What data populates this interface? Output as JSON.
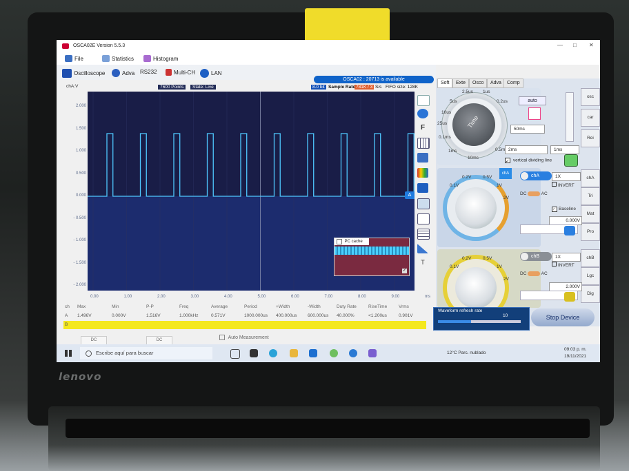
{
  "window": {
    "title": "OSCA02E Version 5.5.3"
  },
  "menu": [
    {
      "label": "File",
      "icon": "file-icon"
    },
    {
      "label": "Statistics",
      "icon": "statistics-icon"
    },
    {
      "label": "Histogram",
      "icon": "histogram-icon"
    }
  ],
  "toolbar": [
    {
      "label": "Oscilloscope",
      "icon": "oscilloscope-icon"
    },
    {
      "label": "Adva",
      "icon": "gear-icon"
    },
    {
      "label": "RS232",
      "icon": ""
    },
    {
      "label": "Multi-CH",
      "icon": "multich-icon"
    },
    {
      "label": "LAN",
      "icon": "globe-icon"
    }
  ],
  "status": {
    "message": "OSCA02 : 20713 is available"
  },
  "info": {
    "points": "7600 Points",
    "state": "State: Live",
    "bits": "8.0 bit",
    "sample_rate_label": "Sample Rate",
    "sample_rate_value": "781K / 3",
    "sample_rate_unit": "S/s",
    "fifo": "FIFO size: 128K"
  },
  "plot": {
    "channel_label": "chA:V",
    "y_ticks": [
      "2.000",
      "1.500",
      "1.000",
      "0.500",
      "0.000",
      "- 0.500",
      "- 1.000",
      "- 1.500",
      "- 2.000"
    ],
    "x_ticks": [
      "0.00",
      "1.00",
      "2.00",
      "3.00",
      "4.00",
      "5.00",
      "6.00",
      "7.00",
      "8.00",
      "9.00",
      "ms"
    ],
    "marker": "A",
    "pc_cache": "PC cache",
    "waveform": {
      "low_v": 0.0,
      "high_v": 1.4,
      "period_ms": 1.0,
      "duty": 0.4,
      "pulses": 10
    }
  },
  "measurements": {
    "headers": [
      "ch",
      "Max",
      "Min",
      "P-P",
      "Freq",
      "Average",
      "Period",
      "+Width",
      "-Width",
      "Duty Rate",
      "RiseTime",
      "Vrms"
    ],
    "row": [
      "A",
      "1.496V",
      "0.000V",
      "1.516V",
      "1.000kHz",
      "0.571V",
      "1000.000us",
      "400.000us",
      "600.000us",
      "40.000%",
      "<1.200us",
      "0.901V"
    ],
    "yellow_label": "B",
    "dc1": "DC",
    "dc2": "DC",
    "auto": "Auto Measurement"
  },
  "right_panel": {
    "tabs": [
      "Soft",
      "Exte",
      "Osco",
      "Adva",
      "Comp"
    ],
    "time_knob": {
      "label": "Time",
      "marks": [
        "2.5us",
        "1us",
        "0.2us",
        "5us",
        "10us",
        "25us",
        "0.1ms",
        "1ms",
        "10ms",
        "0.5ms"
      ]
    },
    "auto": "auto",
    "timebase": "50ms",
    "time_low": "2ms",
    "time_high": "1ms",
    "vertical_dividing": "vertical dividing line",
    "side_buttons": [
      "osc",
      "car",
      "Rei",
      "chA",
      "Tri",
      "Mat",
      "Pro",
      "chB",
      "Lgc",
      "Dig"
    ],
    "chA": {
      "name": "chA",
      "probe": "1X",
      "invert": "INVERT",
      "dc": "DC",
      "ac": "AC",
      "baseline": "Baseline",
      "offset": "0.000V",
      "marks": [
        "0.1V",
        "0.2V",
        "0.5V",
        "1V",
        "2V"
      ]
    },
    "chB": {
      "name": "chB",
      "probe": "1X",
      "invert": "INVERT",
      "dc": "DC",
      "ac": "AC",
      "offset": "2.000V",
      "marks": [
        "0.1V",
        "0.2V",
        "0.5V",
        "1V",
        "2V"
      ]
    },
    "refresh": {
      "label": "Waveform refresh rate",
      "value": "10",
      "fill": 0.4
    },
    "stop": "Stop Device"
  },
  "taskbar": {
    "search": "Escribe aquí para buscar",
    "weather": "12°C  Parc. nublado",
    "time": "09:03 p. m.",
    "date": "19/11/2021"
  },
  "laptop": {
    "brand": "lenovo"
  }
}
